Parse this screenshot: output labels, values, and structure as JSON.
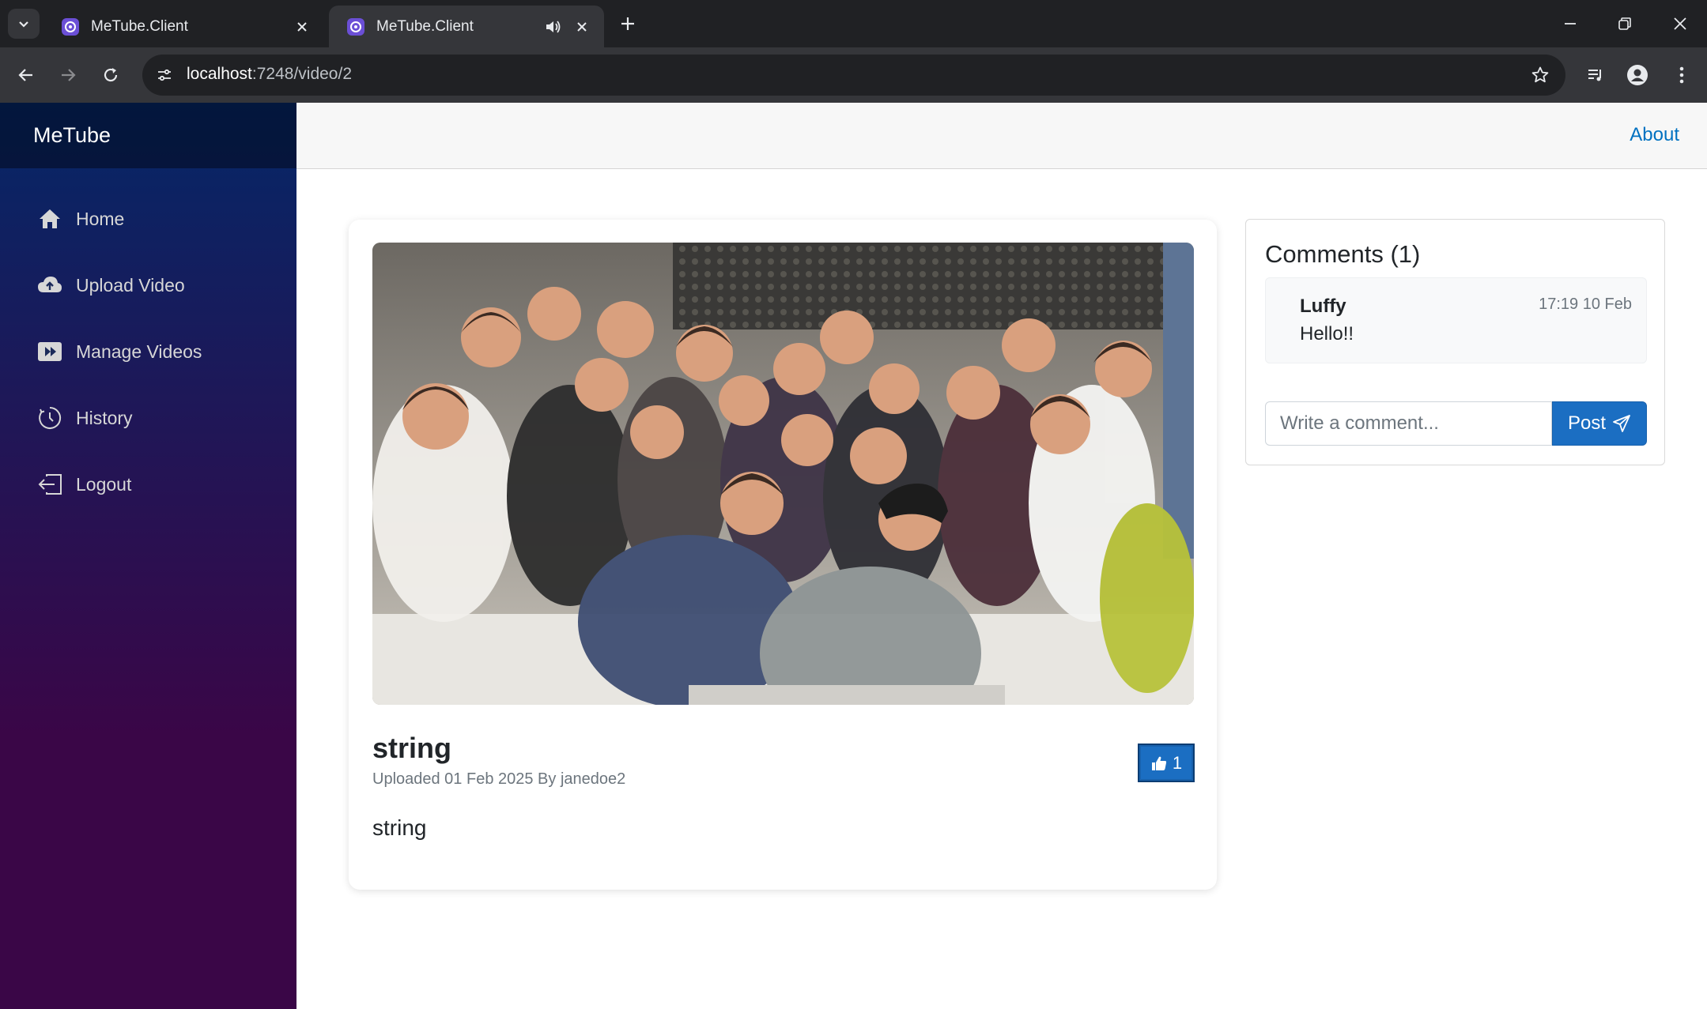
{
  "browser": {
    "tabs": [
      {
        "title": "MeTube.Client",
        "active": false
      },
      {
        "title": "MeTube.Client",
        "active": true,
        "audio": true
      }
    ],
    "url_host": "localhost",
    "url_path": ":7248/video/2",
    "icons": [
      "tab-list-icon",
      "favicon-icon",
      "audio-icon",
      "close-icon",
      "plus-icon",
      "minimize-icon",
      "restore-icon",
      "back-icon",
      "forward-icon",
      "reload-icon",
      "site-info-icon",
      "star-icon",
      "media-controls-icon",
      "profile-icon",
      "menu-icon"
    ]
  },
  "sidebar": {
    "brand": "MeTube",
    "items": [
      {
        "label": "Home",
        "icon": "home-icon"
      },
      {
        "label": "Upload Video",
        "icon": "cloud-upload-icon"
      },
      {
        "label": "Manage Videos",
        "icon": "video-icon"
      },
      {
        "label": "History",
        "icon": "clock-icon"
      },
      {
        "label": "Logout",
        "icon": "logout-icon"
      }
    ]
  },
  "header": {
    "about": "About"
  },
  "video": {
    "title": "string",
    "meta": "Uploaded 01 Feb 2025 By janedoe2",
    "description": "string",
    "likes": "1"
  },
  "comments": {
    "title": "Comments (1)",
    "items": [
      {
        "user": "Luffy",
        "time": "17:19 10 Feb",
        "text": "Hello!!"
      }
    ],
    "input_placeholder": "Write a comment...",
    "post_label": "Post"
  },
  "colors": {
    "primary": "#1b6ec2",
    "link": "#0071c1",
    "sidebar_top": "#052767",
    "sidebar_bottom": "#3a0647"
  }
}
